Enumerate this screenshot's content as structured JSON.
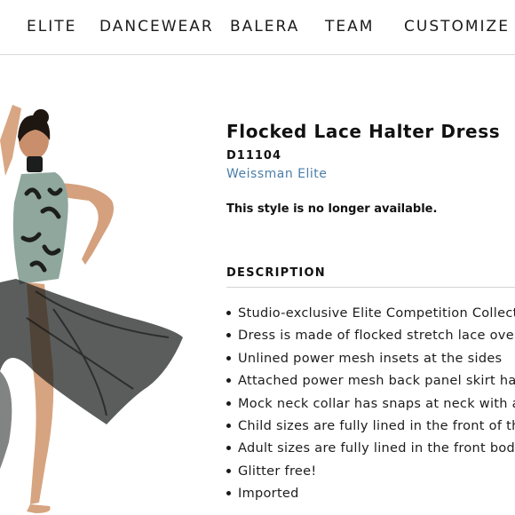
{
  "nav": {
    "items": [
      "ELITE",
      "DANCEWEAR",
      "BALERA",
      "TEAM",
      "CUSTOMIZE"
    ]
  },
  "product": {
    "title": "Flocked Lace Halter Dress",
    "sku": "D11104",
    "brand": "Weissman Elite",
    "availability": "This style is no longer available."
  },
  "description": {
    "heading": "DESCRIPTION",
    "bullets": [
      "Studio-exclusive Elite Competition Collecti",
      "Dress is made of flocked stretch lace over",
      "Unlined power mesh insets at the sides",
      "Attached power mesh back panel skirt has",
      "Mock neck collar has snaps at neck with a",
      "Child sizes are fully lined in the front of the",
      "Adult sizes are fully lined in the front bodic",
      "Glitter free!",
      "Imported"
    ]
  },
  "colors": {
    "brand_link": "#4a7ea8",
    "dress_lace": "#8fa79d",
    "mesh": "#1c1e1d"
  }
}
